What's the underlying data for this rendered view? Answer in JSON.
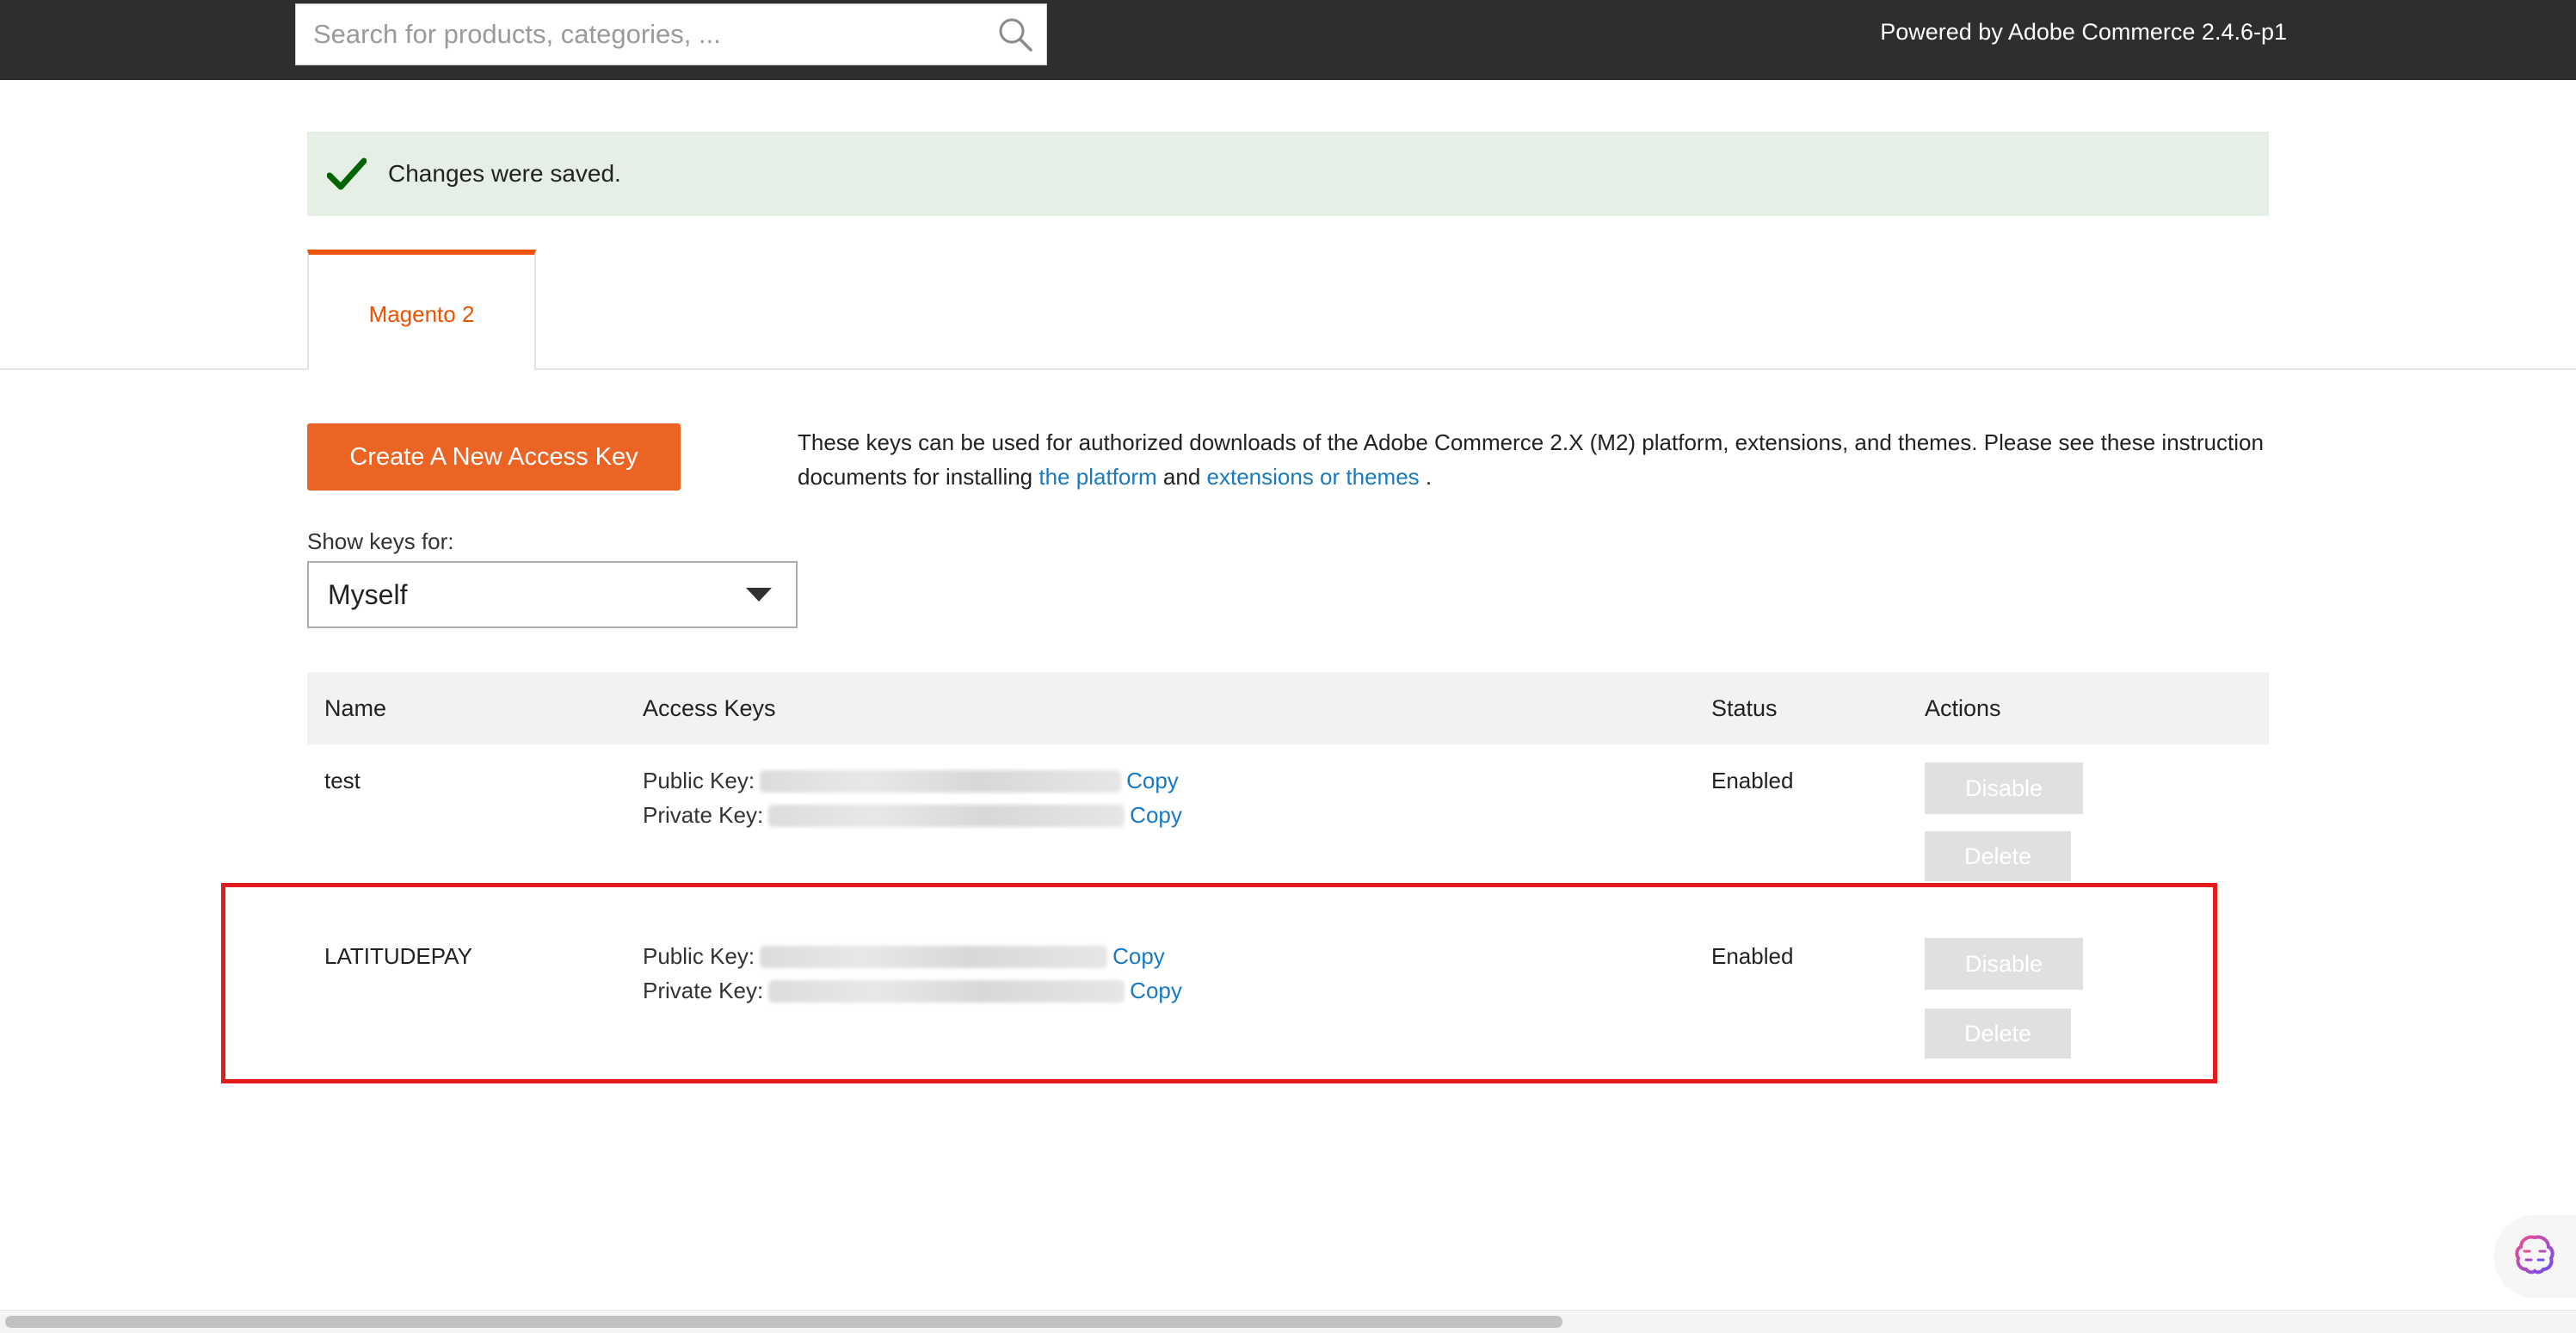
{
  "header": {
    "search_placeholder": "Search for products, categories, ...",
    "search_icon": "search-icon",
    "powered_by": "Powered by Adobe Commerce 2.4.6-p1",
    "background": "#2e2e2e"
  },
  "message": {
    "text": "Changes were saved.",
    "icon": "checkmark-icon",
    "background": "#e5efe5",
    "icon_color": "#006400"
  },
  "tabs": [
    {
      "label": "Magento 2",
      "active": true
    }
  ],
  "accent_color": "#eb5202",
  "create_button": {
    "label": "Create A New Access Key"
  },
  "info": {
    "text_before": "These keys can be used for authorized downloads of the Adobe Commerce 2.X (M2) platform, extensions, and themes. Please see these instruction documents for installing",
    "link1": "the platform",
    "mid": "and",
    "link2": "extensions or themes",
    "end": "."
  },
  "filter": {
    "label": "Show keys for:",
    "selected": "Myself"
  },
  "table": {
    "headers": [
      "Name",
      "Access Keys",
      "Status",
      "Actions"
    ],
    "public_label": "Public Key:",
    "private_label": "Private Key:",
    "copy_label": "Copy",
    "disable_label": "Disable",
    "delete_label": "Delete",
    "rows": [
      {
        "name": "test",
        "status": "Enabled"
      },
      {
        "name": "LATITUDEPAY",
        "status": "Enabled"
      }
    ]
  },
  "floating_button": {
    "icon": "brain-assistant-icon"
  }
}
